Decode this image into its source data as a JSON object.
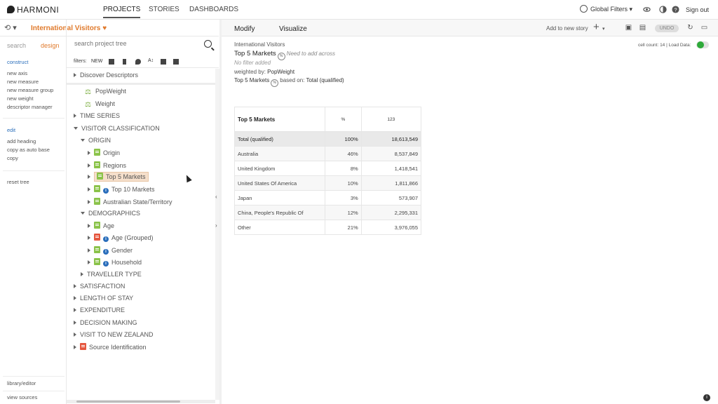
{
  "topnav": {
    "logo": "HARMONI",
    "links": [
      "PROJECTS",
      "STORIES",
      "DASHBOARDS"
    ],
    "global_filters": "Global Filters ▾",
    "sign_out": "Sign out"
  },
  "project": {
    "history_icon": "history-icon",
    "title": "International Visitors",
    "heart": "♥"
  },
  "sidetabs": {
    "search": "search",
    "design": "design",
    "search_placeholder": "search project tree"
  },
  "sidemenu": {
    "construct_head": "construct",
    "construct_items": [
      "new axis",
      "new measure",
      "new measure group",
      "new weight",
      "descriptor manager"
    ],
    "edit_head": "edit",
    "edit_items": [
      "add heading",
      "copy as auto base",
      "copy"
    ],
    "reset": "reset tree",
    "library": "library/editor",
    "view_sources": "view sources"
  },
  "filters": {
    "label": "filters:",
    "new": "NEW"
  },
  "tree": {
    "discover": "Discover Descriptors",
    "popweight": "PopWeight",
    "weight": "Weight",
    "time_series": "TIME SERIES",
    "visitor_class": "VISITOR CLASSIFICATION",
    "origin_group": "ORIGIN",
    "origin": "Origin",
    "regions": "Regions",
    "top5": "Top 5 Markets",
    "top10": "Top 10 Markets",
    "aus_state": "Australian State/Territory",
    "demographics": "DEMOGRAPHICS",
    "age": "Age",
    "age_grouped": "Age (Grouped)",
    "gender": "Gender",
    "household": "Household",
    "traveller_type": "TRAVELLER TYPE",
    "satisfaction": "SATISFACTION",
    "length_of_stay": "LENGTH OF STAY",
    "expenditure": "EXPENDITURE",
    "decision_making": "DECISION MAKING",
    "visit_nz": "VISIT TO NEW ZEALAND",
    "source_id": "Source Identification"
  },
  "rightbar": {
    "modify": "Modify",
    "visualize": "Visualize",
    "add_to_story": "Add to new story",
    "undo": "UNDO"
  },
  "meta": {
    "project": "International Visitors",
    "title": "Top 5 Markets",
    "need_across": "Need to add across",
    "no_filter": "No filter added",
    "weighted_label": "weighted by:",
    "weighted_value": "PopWeight",
    "based_title": "Top 5 Markets",
    "based_label": "based on:",
    "based_value": "Total (qualified)",
    "cell_count": "cell count: 14 | Load Data:"
  },
  "table": {
    "row_header": "Top 5 Markets",
    "col_pct": "%",
    "col_num": "123",
    "rows": [
      {
        "label": "Total (qualified)",
        "pct": "100%",
        "num": "18,613,549"
      },
      {
        "label": "Australia",
        "pct": "46%",
        "num": "8,537,849"
      },
      {
        "label": "United Kingdom",
        "pct": "8%",
        "num": "1,418,541"
      },
      {
        "label": "United States Of America",
        "pct": "10%",
        "num": "1,811,866"
      },
      {
        "label": "Japan",
        "pct": "3%",
        "num": "573,907"
      },
      {
        "label": "China, People's Republic Of",
        "pct": "12%",
        "num": "2,295,331"
      },
      {
        "label": "Other",
        "pct": "21%",
        "num": "3,976,055"
      }
    ]
  }
}
